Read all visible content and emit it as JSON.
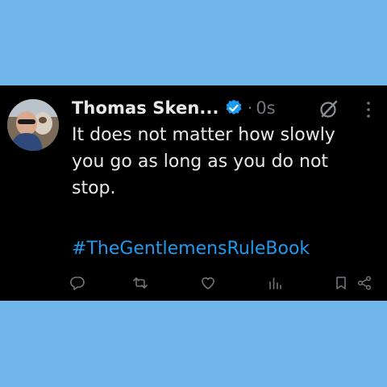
{
  "tweet": {
    "author_name": "Thomas Sken...",
    "separator": "·",
    "timestamp": "0s",
    "text": "It does not matter how slowly you go as long as you do not stop.",
    "hashtag": "#TheGentlemensRuleBook"
  },
  "icons": {
    "verified": "verified-badge-icon",
    "grok": "grok-icon",
    "more": "more-vertical-icon",
    "reply": "reply-icon",
    "retweet": "retweet-icon",
    "like": "like-icon",
    "views": "views-icon",
    "bookmark": "bookmark-icon",
    "share": "share-icon"
  },
  "colors": {
    "background_outer": "#70b6ea",
    "tweet_background": "#000000",
    "text_primary": "#e7e9ea",
    "text_secondary": "#71767b",
    "accent": "#1d9bf0"
  }
}
